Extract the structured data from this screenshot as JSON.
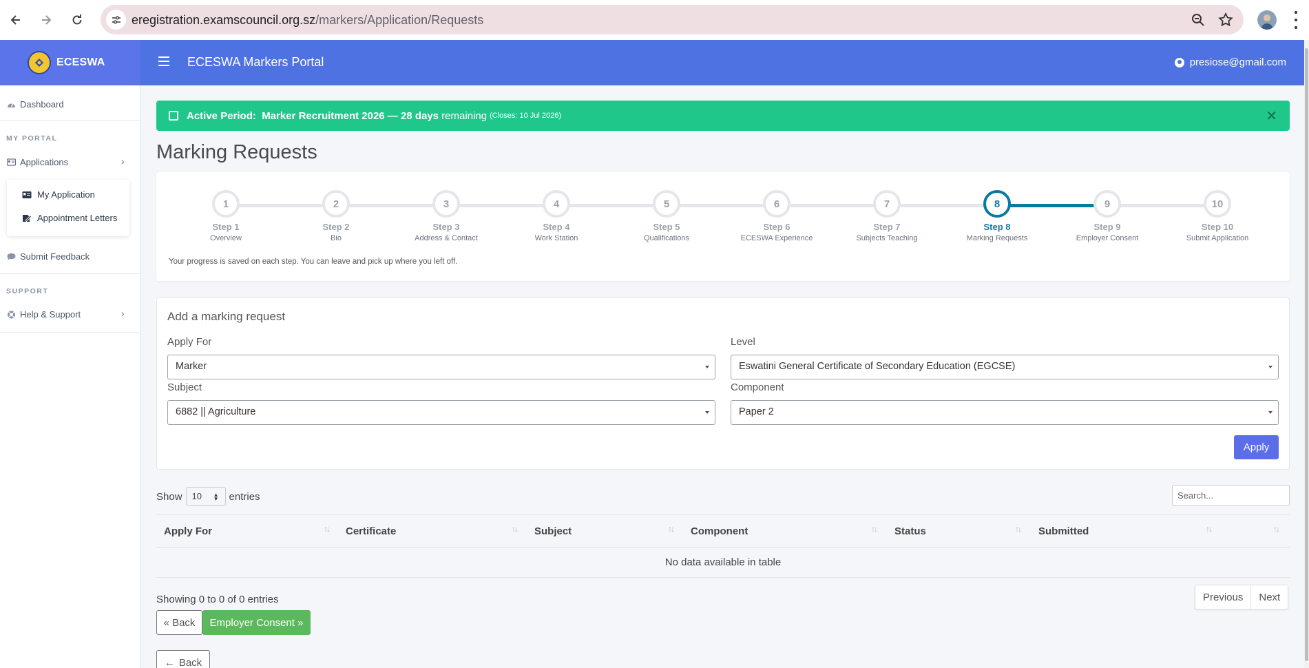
{
  "browser": {
    "url_domain": "eregistration.examscouncil.org.sz",
    "url_path": "/markers/Application/Requests"
  },
  "header": {
    "brand": "ECESWA",
    "portal_title": "ECESWA Markers Portal",
    "user_email": "presiose@gmail.com"
  },
  "sidebar": {
    "dashboard": "Dashboard",
    "section_portal": "MY PORTAL",
    "applications": "Applications",
    "my_application": "My Application",
    "appointment_letters": "Appointment Letters",
    "submit_feedback": "Submit Feedback",
    "section_support": "SUPPORT",
    "help_support": "Help & Support"
  },
  "alert": {
    "label": "Active Period:",
    "period": "Marker Recruitment 2026 — 28 days",
    "remaining": "remaining",
    "closes": "(Closes: 10 Jul 2026)",
    "close_glyph": "✕"
  },
  "page_title": "Marking Requests",
  "stepper": {
    "current": 8,
    "steps": [
      {
        "num": "1",
        "label": "Step 1",
        "sub": "Overview"
      },
      {
        "num": "2",
        "label": "Step 2",
        "sub": "Bio"
      },
      {
        "num": "3",
        "label": "Step 3",
        "sub": "Address & Contact"
      },
      {
        "num": "4",
        "label": "Step 4",
        "sub": "Work Station"
      },
      {
        "num": "5",
        "label": "Step 5",
        "sub": "Qualifications"
      },
      {
        "num": "6",
        "label": "Step 6",
        "sub": "ECESWA Experience"
      },
      {
        "num": "7",
        "label": "Step 7",
        "sub": "Subjects Teaching"
      },
      {
        "num": "8",
        "label": "Step 8",
        "sub": "Marking Requests"
      },
      {
        "num": "9",
        "label": "Step 9",
        "sub": "Employer Consent"
      },
      {
        "num": "10",
        "label": "Step 10",
        "sub": "Submit Application"
      }
    ],
    "note": "Your progress is saved on each step. You can leave and pick up where you left off."
  },
  "form": {
    "title": "Add a marking request",
    "apply_for_label": "Apply For",
    "apply_for_value": "Marker",
    "level_label": "Level",
    "level_value": "Eswatini General Certificate of Secondary Education (EGCSE)",
    "subject_label": "Subject",
    "subject_value": "6882 || Agriculture",
    "component_label": "Component",
    "component_value": "Paper 2",
    "apply_button": "Apply"
  },
  "table": {
    "show": "Show",
    "entries_value": "10",
    "entries": "entries",
    "search_placeholder": "Search...",
    "columns": [
      "Apply For",
      "Certificate",
      "Subject",
      "Component",
      "Status",
      "Submitted"
    ],
    "empty": "No data available in table",
    "info": "Showing 0 to 0 of 0 entries",
    "previous": "Previous",
    "next": "Next"
  },
  "actions": {
    "back": "« Back",
    "next": "Employer Consent »",
    "back2": "Back"
  },
  "colors": {
    "header": "#4f72e3",
    "brand": "#5b74ea",
    "alert": "#1fc88a",
    "step_active": "#0a7aa3",
    "apply": "#5b6ee8",
    "next_button": "#5cb85c"
  }
}
